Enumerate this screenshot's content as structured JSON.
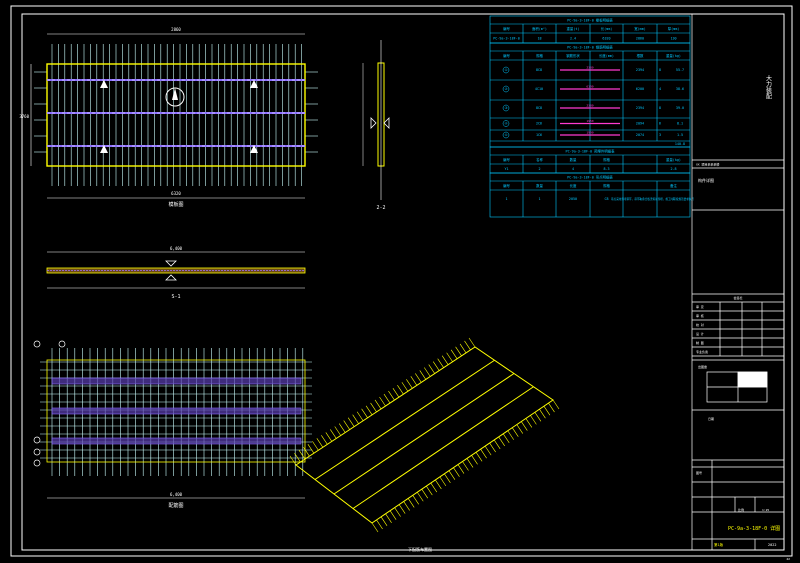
{
  "drawing": {
    "plan_title": "模板图",
    "section_s1_label": "S-1",
    "section_22_label": "2-2",
    "rebar_title": "配筋图",
    "sheet_caption": "下配筋布置图",
    "dim_top": "2860",
    "dim_bottom": "6320",
    "dim_long": "6,400",
    "dim_rebar_bottom": "6,400",
    "dim_left": "3760",
    "elevation_top": "180",
    "elevation_bottom": "-150"
  },
  "table_main": {
    "title": "PC-9a-3-18F-0 楼板明细表",
    "headers": [
      "编号",
      "面积(m²)",
      "重量(t)",
      "长(mm)",
      "宽(mm)",
      "厚(mm)"
    ],
    "row": [
      "PC-9a-3-18F-0",
      "18",
      "2.4",
      "6320",
      "2860",
      "130"
    ]
  },
  "table_rebar": {
    "title": "PC-9a-3-18F-0 钢筋明细表",
    "headers": [
      "编号",
      "规格",
      "钢筋形状",
      "长度(mm)",
      "根数",
      "重量(kg)"
    ],
    "rows": [
      {
        "id": "①",
        "spec": "8C8",
        "len_label": "2380",
        "length": "2394",
        "count": "8",
        "weight": "55.7"
      },
      {
        "id": "②",
        "spec": "4C10",
        "len_label": "6190",
        "length": "6200",
        "count": "4",
        "weight": "38.6"
      },
      {
        "id": "③",
        "spec": "8C8",
        "len_label": "2380",
        "length": "2394",
        "count": "8",
        "weight": "39.0"
      },
      {
        "id": "④",
        "spec": "2C6",
        "len_label": "1950",
        "length": "2094",
        "count": "6",
        "weight": "8.1"
      },
      {
        "id": "⑤",
        "spec": "1C6",
        "len_label": "1990",
        "length": "2074",
        "count": "3",
        "weight": "1.5"
      }
    ],
    "total": "140.8"
  },
  "table_embed": {
    "title": "PC-9a-3-18F-0 预埋件明细表",
    "headers": [
      "编号",
      "名称",
      "数量",
      "规格",
      "",
      "重量(kg)"
    ],
    "row": [
      "Y1",
      "2",
      "4",
      "8.3",
      "",
      "2.8"
    ]
  },
  "table_lift": {
    "title": "PC-9a-3-18F-0 吊点明细表",
    "headers": [
      "编号",
      "数量",
      "长度",
      "规格",
      "",
      "备注"
    ],
    "row": [
      "1",
      "1",
      "2050",
      "C8",
      "1",
      "1"
    ],
    "note": "吊点采用预埋吊环，吊环在叠合板浇筑前预埋，施工时需按规范要求执行"
  },
  "title_block": {
    "company": "大力装配",
    "project_label": "XX 项目某某某楼",
    "drawing_label": "构件详图",
    "review_labels": [
      "审 定",
      "审 核",
      "校 对",
      "设 计",
      "制 图",
      "专业负责"
    ],
    "stamp_label": "出图章",
    "sub_label": "会签栏",
    "date_label": "日期",
    "sheet_label": "图号",
    "scale_label": "比例",
    "scale_value": "1:25",
    "drawing_name": "PC-9a-3-18F-0 详图",
    "sheet_no": "2022",
    "version": "第1版",
    "page_no": "42"
  }
}
